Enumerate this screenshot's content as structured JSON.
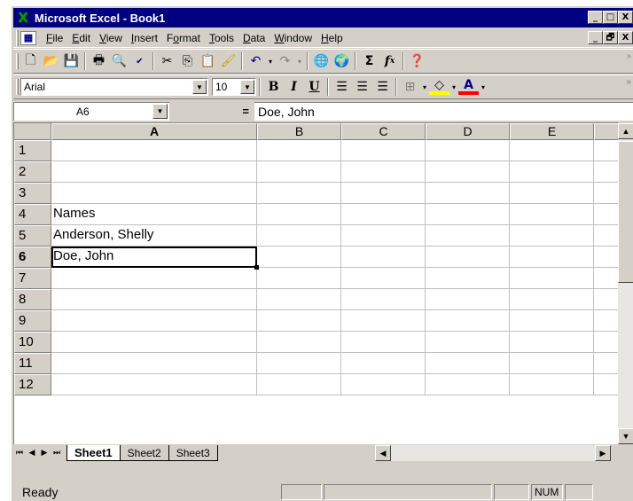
{
  "window": {
    "title": "Microsoft Excel - Book1",
    "min_glyph": "_",
    "max_glyph": "□",
    "close_glyph": "X",
    "restore_glyph": "🗗"
  },
  "menu": {
    "items": [
      {
        "pre": "",
        "u": "F",
        "post": "ile"
      },
      {
        "pre": "",
        "u": "E",
        "post": "dit"
      },
      {
        "pre": "",
        "u": "V",
        "post": "iew"
      },
      {
        "pre": "",
        "u": "I",
        "post": "nsert"
      },
      {
        "pre": "F",
        "u": "o",
        "post": "rmat"
      },
      {
        "pre": "",
        "u": "T",
        "post": "ools"
      },
      {
        "pre": "",
        "u": "D",
        "post": "ata"
      },
      {
        "pre": "",
        "u": "W",
        "post": "indow"
      },
      {
        "pre": "",
        "u": "H",
        "post": "elp"
      }
    ]
  },
  "formatting": {
    "font": "Arial",
    "size": "10"
  },
  "formula_bar": {
    "name_box": "A6",
    "equals": "=",
    "content": "Doe, John"
  },
  "columns": [
    "A",
    "B",
    "C",
    "D",
    "E"
  ],
  "active_column": "A",
  "active_row": "6",
  "rows": [
    {
      "num": "1",
      "A": ""
    },
    {
      "num": "2",
      "A": ""
    },
    {
      "num": "3",
      "A": ""
    },
    {
      "num": "4",
      "A": "Names"
    },
    {
      "num": "5",
      "A": "Anderson, Shelly"
    },
    {
      "num": "6",
      "A": "Doe, John"
    },
    {
      "num": "7",
      "A": ""
    },
    {
      "num": "8",
      "A": ""
    },
    {
      "num": "9",
      "A": ""
    },
    {
      "num": "10",
      "A": ""
    },
    {
      "num": "11",
      "A": ""
    },
    {
      "num": "12",
      "A": ""
    }
  ],
  "sheets": [
    "Sheet1",
    "Sheet2",
    "Sheet3"
  ],
  "active_sheet": "Sheet1",
  "status": {
    "text": "Ready",
    "num": "NUM"
  }
}
